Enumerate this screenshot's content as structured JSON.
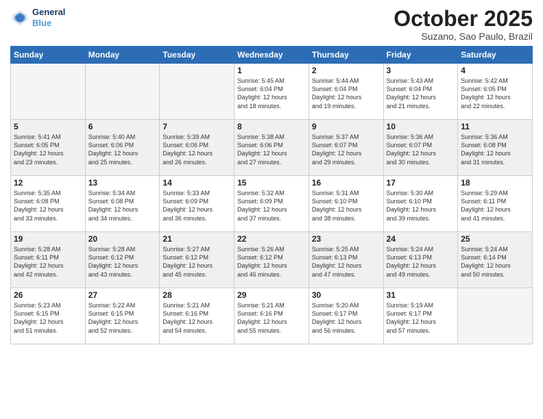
{
  "header": {
    "logo_line1": "General",
    "logo_line2": "Blue",
    "month": "October 2025",
    "location": "Suzano, Sao Paulo, Brazil"
  },
  "weekdays": [
    "Sunday",
    "Monday",
    "Tuesday",
    "Wednesday",
    "Thursday",
    "Friday",
    "Saturday"
  ],
  "weeks": [
    [
      {
        "day": null,
        "info": null
      },
      {
        "day": null,
        "info": null
      },
      {
        "day": null,
        "info": null
      },
      {
        "day": "1",
        "info": "Sunrise: 5:45 AM\nSunset: 6:04 PM\nDaylight: 12 hours\nand 18 minutes."
      },
      {
        "day": "2",
        "info": "Sunrise: 5:44 AM\nSunset: 6:04 PM\nDaylight: 12 hours\nand 19 minutes."
      },
      {
        "day": "3",
        "info": "Sunrise: 5:43 AM\nSunset: 6:04 PM\nDaylight: 12 hours\nand 21 minutes."
      },
      {
        "day": "4",
        "info": "Sunrise: 5:42 AM\nSunset: 6:05 PM\nDaylight: 12 hours\nand 22 minutes."
      }
    ],
    [
      {
        "day": "5",
        "info": "Sunrise: 5:41 AM\nSunset: 6:05 PM\nDaylight: 12 hours\nand 23 minutes."
      },
      {
        "day": "6",
        "info": "Sunrise: 5:40 AM\nSunset: 6:06 PM\nDaylight: 12 hours\nand 25 minutes."
      },
      {
        "day": "7",
        "info": "Sunrise: 5:39 AM\nSunset: 6:06 PM\nDaylight: 12 hours\nand 26 minutes."
      },
      {
        "day": "8",
        "info": "Sunrise: 5:38 AM\nSunset: 6:06 PM\nDaylight: 12 hours\nand 27 minutes."
      },
      {
        "day": "9",
        "info": "Sunrise: 5:37 AM\nSunset: 6:07 PM\nDaylight: 12 hours\nand 29 minutes."
      },
      {
        "day": "10",
        "info": "Sunrise: 5:36 AM\nSunset: 6:07 PM\nDaylight: 12 hours\nand 30 minutes."
      },
      {
        "day": "11",
        "info": "Sunrise: 5:36 AM\nSunset: 6:08 PM\nDaylight: 12 hours\nand 31 minutes."
      }
    ],
    [
      {
        "day": "12",
        "info": "Sunrise: 5:35 AM\nSunset: 6:08 PM\nDaylight: 12 hours\nand 33 minutes."
      },
      {
        "day": "13",
        "info": "Sunrise: 5:34 AM\nSunset: 6:08 PM\nDaylight: 12 hours\nand 34 minutes."
      },
      {
        "day": "14",
        "info": "Sunrise: 5:33 AM\nSunset: 6:09 PM\nDaylight: 12 hours\nand 36 minutes."
      },
      {
        "day": "15",
        "info": "Sunrise: 5:32 AM\nSunset: 6:09 PM\nDaylight: 12 hours\nand 37 minutes."
      },
      {
        "day": "16",
        "info": "Sunrise: 5:31 AM\nSunset: 6:10 PM\nDaylight: 12 hours\nand 38 minutes."
      },
      {
        "day": "17",
        "info": "Sunrise: 5:30 AM\nSunset: 6:10 PM\nDaylight: 12 hours\nand 39 minutes."
      },
      {
        "day": "18",
        "info": "Sunrise: 5:29 AM\nSunset: 6:11 PM\nDaylight: 12 hours\nand 41 minutes."
      }
    ],
    [
      {
        "day": "19",
        "info": "Sunrise: 5:28 AM\nSunset: 6:11 PM\nDaylight: 12 hours\nand 42 minutes."
      },
      {
        "day": "20",
        "info": "Sunrise: 5:28 AM\nSunset: 6:12 PM\nDaylight: 12 hours\nand 43 minutes."
      },
      {
        "day": "21",
        "info": "Sunrise: 5:27 AM\nSunset: 6:12 PM\nDaylight: 12 hours\nand 45 minutes."
      },
      {
        "day": "22",
        "info": "Sunrise: 5:26 AM\nSunset: 6:12 PM\nDaylight: 12 hours\nand 46 minutes."
      },
      {
        "day": "23",
        "info": "Sunrise: 5:25 AM\nSunset: 6:13 PM\nDaylight: 12 hours\nand 47 minutes."
      },
      {
        "day": "24",
        "info": "Sunrise: 5:24 AM\nSunset: 6:13 PM\nDaylight: 12 hours\nand 49 minutes."
      },
      {
        "day": "25",
        "info": "Sunrise: 5:24 AM\nSunset: 6:14 PM\nDaylight: 12 hours\nand 50 minutes."
      }
    ],
    [
      {
        "day": "26",
        "info": "Sunrise: 5:23 AM\nSunset: 6:15 PM\nDaylight: 12 hours\nand 51 minutes."
      },
      {
        "day": "27",
        "info": "Sunrise: 5:22 AM\nSunset: 6:15 PM\nDaylight: 12 hours\nand 52 minutes."
      },
      {
        "day": "28",
        "info": "Sunrise: 5:21 AM\nSunset: 6:16 PM\nDaylight: 12 hours\nand 54 minutes."
      },
      {
        "day": "29",
        "info": "Sunrise: 5:21 AM\nSunset: 6:16 PM\nDaylight: 12 hours\nand 55 minutes."
      },
      {
        "day": "30",
        "info": "Sunrise: 5:20 AM\nSunset: 6:17 PM\nDaylight: 12 hours\nand 56 minutes."
      },
      {
        "day": "31",
        "info": "Sunrise: 5:19 AM\nSunset: 6:17 PM\nDaylight: 12 hours\nand 57 minutes."
      },
      {
        "day": null,
        "info": null
      }
    ]
  ]
}
